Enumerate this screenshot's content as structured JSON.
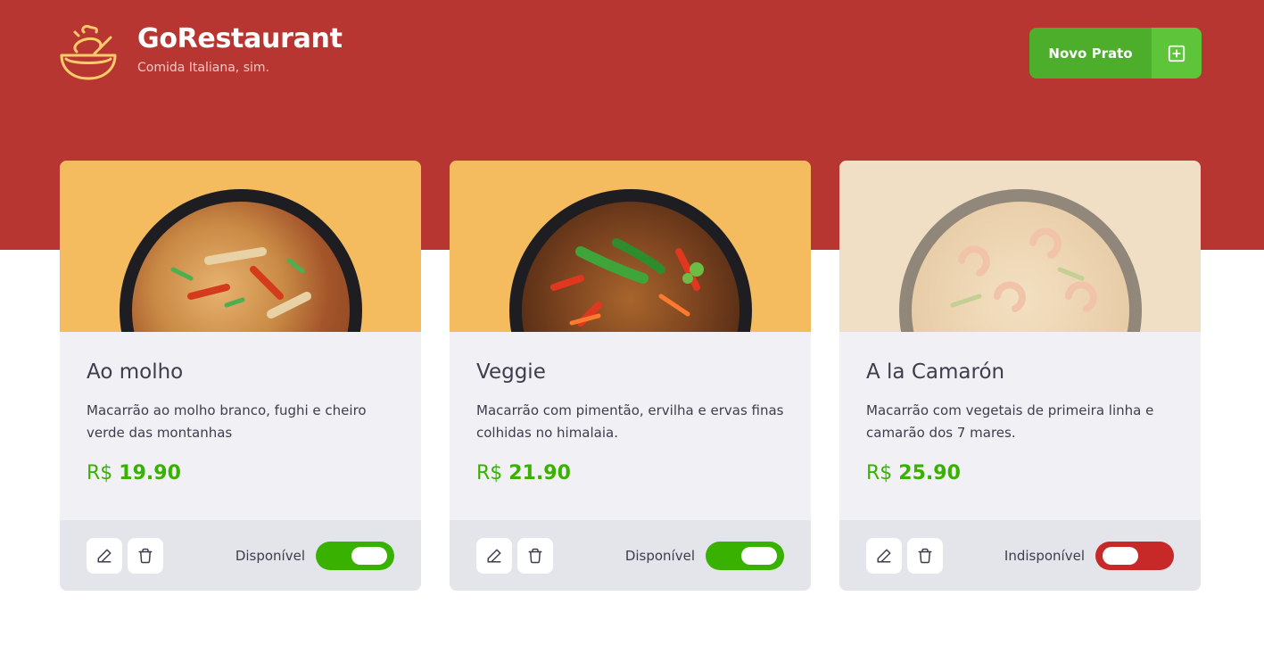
{
  "header": {
    "title": "GoRestaurant",
    "subtitle": "Comida Italiana, sim.",
    "new_button_label": "Novo Prato",
    "new_button_icon": "plus-square-icon",
    "logo_icon": "bowl-icon",
    "bg_color": "#b83631"
  },
  "currency": "R$",
  "foods": [
    {
      "name": "Ao molho",
      "description": "Macarrão ao molho branco, fughi e cheiro verde das montanhas",
      "price": "19.90",
      "available": true,
      "availability_label": "Disponível"
    },
    {
      "name": "Veggie",
      "description": "Macarrão com pimentão, ervilha e ervas finas colhidas no himalaia.",
      "price": "21.90",
      "available": true,
      "availability_label": "Disponível"
    },
    {
      "name": "A la Camarón",
      "description": "Macarrão com vegetais de primeira linha e camarão dos 7 mares.",
      "price": "25.90",
      "available": false,
      "availability_label": "Indisponível"
    }
  ],
  "colors": {
    "accent_green": "#39b100",
    "unavailable_red": "#c72828",
    "card_image_bg": "#f4bc5f"
  }
}
